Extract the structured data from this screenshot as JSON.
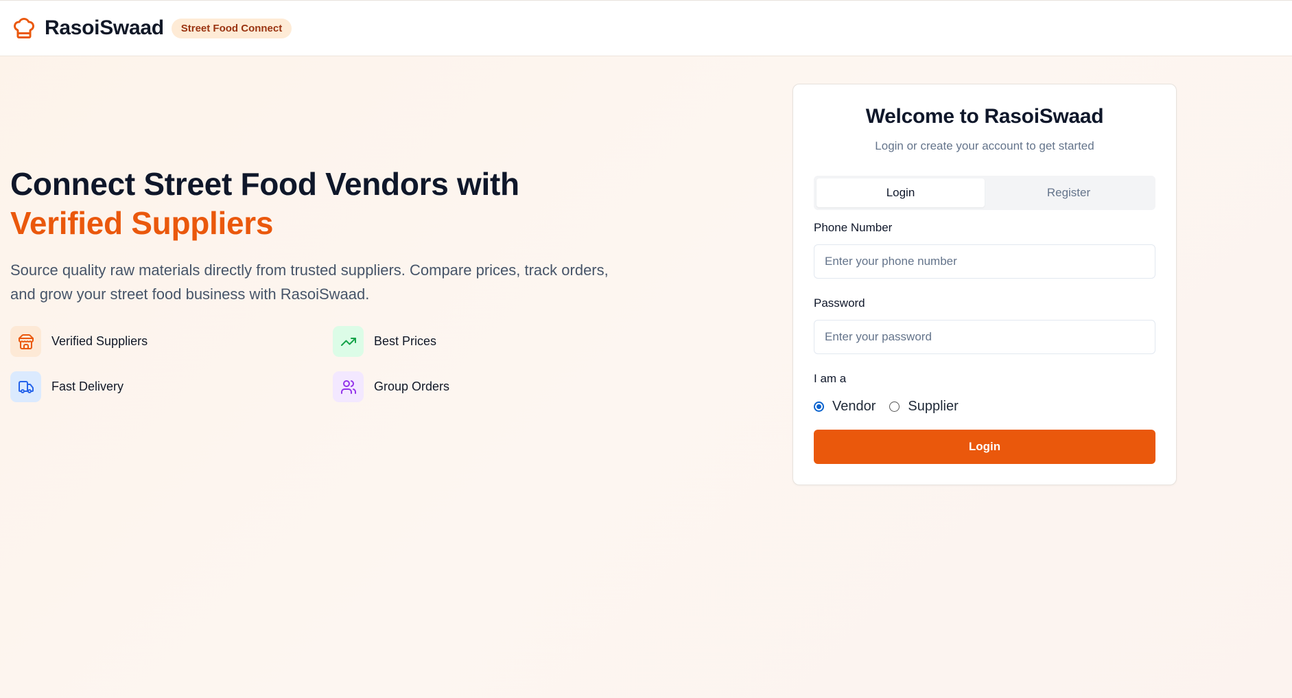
{
  "header": {
    "logo_icon": "chef-hat-icon",
    "brand": "RasoiSwaad",
    "badge": "Street Food Connect"
  },
  "hero": {
    "title_line1": "Connect Street Food Vendors with",
    "title_accent": "Verified Suppliers",
    "description": "Source quality raw materials directly from trusted suppliers. Compare prices, track orders, and grow your street food business with RasoiSwaad.",
    "features": [
      {
        "label": "Verified Suppliers",
        "icon": "store-icon",
        "bg": "#fde9d6",
        "color": "#ea580c"
      },
      {
        "label": "Best Prices",
        "icon": "trending-up-icon",
        "bg": "#dcfce7",
        "color": "#16a34a"
      },
      {
        "label": "Fast Delivery",
        "icon": "truck-icon",
        "bg": "#dbeafe",
        "color": "#2563eb"
      },
      {
        "label": "Group Orders",
        "icon": "users-icon",
        "bg": "#f3e8ff",
        "color": "#9333ea"
      }
    ]
  },
  "card": {
    "title": "Welcome to RasoiSwaad",
    "subtitle": "Login or create your account to get started",
    "tabs": [
      {
        "label": "Login",
        "active": true
      },
      {
        "label": "Register",
        "active": false
      }
    ],
    "phone": {
      "label": "Phone Number",
      "placeholder": "Enter your phone number",
      "value": ""
    },
    "password": {
      "label": "Password",
      "placeholder": "Enter your password",
      "value": ""
    },
    "role": {
      "label": "I am a",
      "options": [
        {
          "label": "Vendor",
          "checked": true
        },
        {
          "label": "Supplier",
          "checked": false
        }
      ]
    },
    "submit_label": "Login"
  },
  "colors": {
    "accent": "#ea580c",
    "radio_checked": "#0b63ce"
  }
}
